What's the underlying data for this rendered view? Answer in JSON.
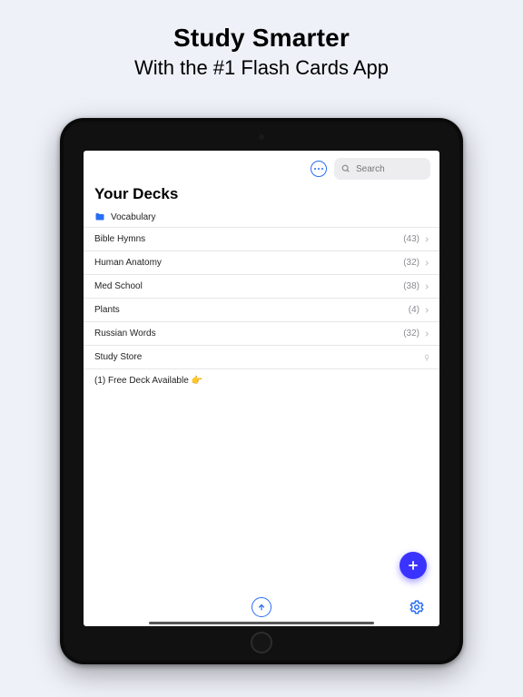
{
  "hero": {
    "title": "Study Smarter",
    "subtitle": "With the #1 Flash Cards App"
  },
  "topbar": {
    "search_placeholder": "Search"
  },
  "section_title": "Your Decks",
  "folder": {
    "name": "Vocabulary"
  },
  "decks": [
    {
      "name": "Bible Hymns",
      "count": "(43)"
    },
    {
      "name": "Human Anatomy",
      "count": "(32)"
    },
    {
      "name": "Med School",
      "count": "(38)"
    },
    {
      "name": "Plants",
      "count": "(4)"
    },
    {
      "name": "Russian Words",
      "count": "(32)"
    }
  ],
  "store": {
    "label": "Study Store"
  },
  "promo": {
    "text": "(1) Free Deck Available 👉"
  },
  "colors": {
    "accent": "#2a6df4",
    "fab": "#3a33ff"
  }
}
